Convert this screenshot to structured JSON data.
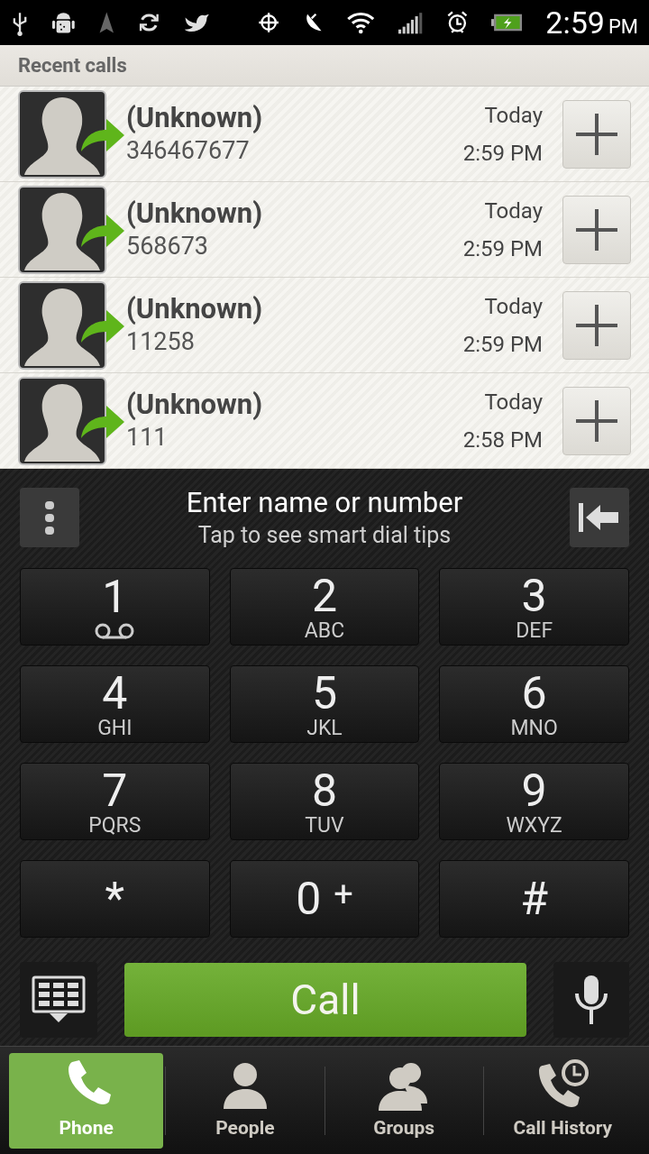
{
  "status_bar": {
    "time": "2:59",
    "ampm": "PM"
  },
  "recent_calls": {
    "title": "Recent calls",
    "rows": [
      {
        "name": "(Unknown)",
        "number": "346467677",
        "date": "Today",
        "time": "2:59 PM"
      },
      {
        "name": "(Unknown)",
        "number": "568673",
        "date": "Today",
        "time": "2:59 PM"
      },
      {
        "name": "(Unknown)",
        "number": "11258",
        "date": "Today",
        "time": "2:59 PM"
      },
      {
        "name": "(Unknown)",
        "number": "111",
        "date": "Today",
        "time": "2:58 PM"
      }
    ]
  },
  "dialer": {
    "placeholder": "Enter name or number",
    "hint": "Tap to see smart dial tips",
    "keys": [
      {
        "kind": "voicemail",
        "digit": "1"
      },
      {
        "kind": "letters",
        "digit": "2",
        "letters": "ABC"
      },
      {
        "kind": "letters",
        "digit": "3",
        "letters": "DEF"
      },
      {
        "kind": "letters",
        "digit": "4",
        "letters": "GHI"
      },
      {
        "kind": "letters",
        "digit": "5",
        "letters": "JKL"
      },
      {
        "kind": "letters",
        "digit": "6",
        "letters": "MNO"
      },
      {
        "kind": "letters",
        "digit": "7",
        "letters": "PQRS"
      },
      {
        "kind": "letters",
        "digit": "8",
        "letters": "TUV"
      },
      {
        "kind": "letters",
        "digit": "9",
        "letters": "WXYZ"
      },
      {
        "kind": "plain",
        "digit": "*"
      },
      {
        "kind": "plus",
        "digit": "0",
        "extra": "+"
      },
      {
        "kind": "plain",
        "digit": "#"
      }
    ],
    "call_button": "Call"
  },
  "tabs": [
    {
      "kind": "phone",
      "label": "Phone",
      "selected": true
    },
    {
      "kind": "person",
      "label": "People",
      "selected": false
    },
    {
      "kind": "group",
      "label": "Groups",
      "selected": false
    },
    {
      "kind": "history",
      "label": "Call History",
      "selected": false
    }
  ]
}
